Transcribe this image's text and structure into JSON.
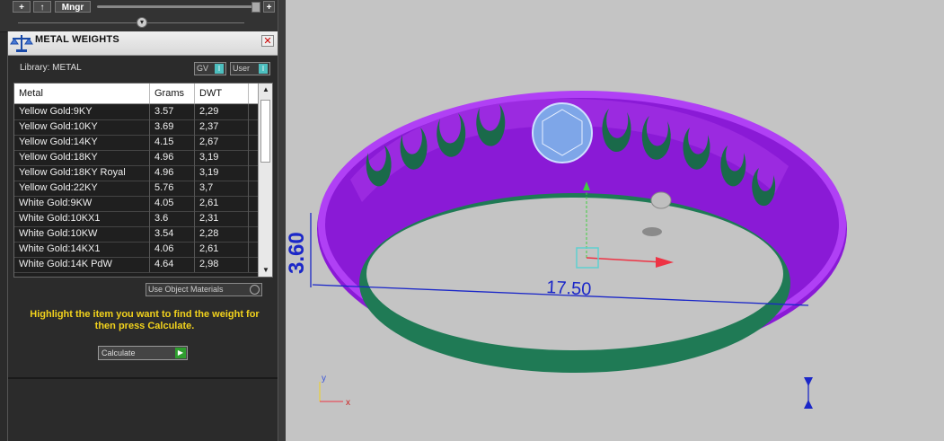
{
  "toolbar": {
    "add_label": "+",
    "up_label": "↑",
    "mngr_label": "Mngr",
    "plus_right_label": "+"
  },
  "panel": {
    "title": "METAL WEIGHTS",
    "close_label": "✕",
    "library_label": "Library: METAL",
    "gv_label": "GV",
    "user_label": "User"
  },
  "table": {
    "headers": [
      "Metal",
      "Grams",
      "DWT"
    ],
    "rows": [
      [
        "Yellow Gold:9KY",
        "3.57",
        "2,29"
      ],
      [
        "Yellow Gold:10KY",
        "3.69",
        "2,37"
      ],
      [
        "Yellow Gold:14KY",
        "4.15",
        "2,67"
      ],
      [
        "Yellow Gold:18KY",
        "4.96",
        "3,19"
      ],
      [
        "Yellow Gold:18KY Royal",
        "4.96",
        "3,19"
      ],
      [
        "Yellow Gold:22KY",
        "5.76",
        "3,7"
      ],
      [
        "White Gold:9KW",
        "4.05",
        "2,61"
      ],
      [
        "White Gold:10KX1",
        "3.6",
        "2,31"
      ],
      [
        "White Gold:10KW",
        "3.54",
        "2,28"
      ],
      [
        "White Gold:14KX1",
        "4.06",
        "2,61"
      ],
      [
        "White Gold:14K PdW",
        "4.64",
        "2,98"
      ]
    ]
  },
  "use_object_materials": "Use Object Materials",
  "instructions": "Highlight the item you want to find the weight for then press Calculate.",
  "calculate_label": "Calculate",
  "viewport": {
    "dim_height": "3.60",
    "dim_width": "17.50",
    "axis_y": "y",
    "axis_x": "x"
  }
}
